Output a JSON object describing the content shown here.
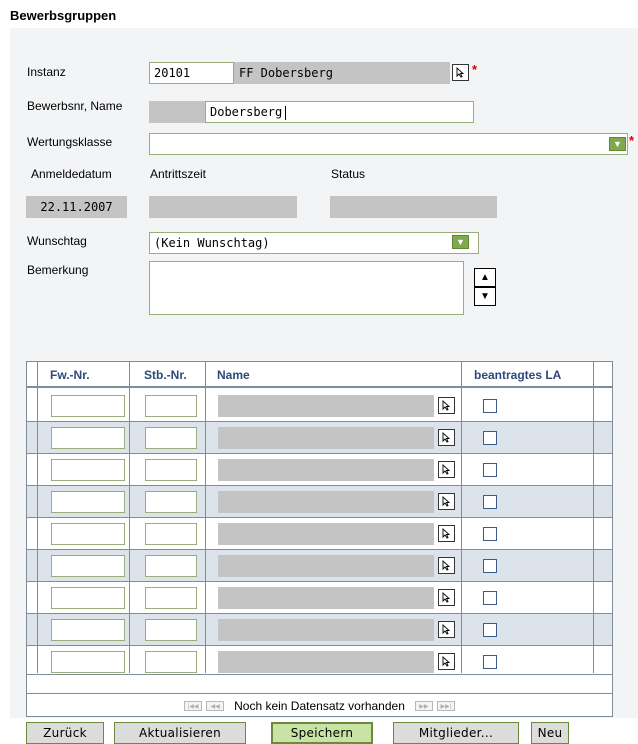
{
  "page_title": "Bewerbsgruppen",
  "form": {
    "instanz_label": "Instanz",
    "instanz_code": "20101",
    "instanz_name": "FF Dobersberg",
    "bewerbsnr_label": "Bewerbsnr, Name",
    "bewerbsnr_value": "",
    "name_value": "Dobersberg",
    "wertungsklasse_label": "Wertungsklasse",
    "wertungsklasse_value": "",
    "anmeldedatum_label": "Anmeldedatum",
    "anmeldedatum_value": "22.11.2007",
    "antrittszeit_label": "Antrittszeit",
    "antrittszeit_value": "",
    "status_label": "Status",
    "status_value": "",
    "wunschtag_label": "Wunschtag",
    "wunschtag_value": "(Kein Wunschtag)",
    "bemerkung_label": "Bemerkung",
    "bemerkung_value": "",
    "required_mark": "*"
  },
  "grid": {
    "headers": [
      "Fw.-Nr.",
      "Stb.-Nr.",
      "Name",
      "beantragtes LA"
    ],
    "rows": [
      {
        "fw": "",
        "stb": "",
        "name": "",
        "la": false
      },
      {
        "fw": "",
        "stb": "",
        "name": "",
        "la": false
      },
      {
        "fw": "",
        "stb": "",
        "name": "",
        "la": false
      },
      {
        "fw": "",
        "stb": "",
        "name": "",
        "la": false
      },
      {
        "fw": "",
        "stb": "",
        "name": "",
        "la": false
      },
      {
        "fw": "",
        "stb": "",
        "name": "",
        "la": false
      },
      {
        "fw": "",
        "stb": "",
        "name": "",
        "la": false
      },
      {
        "fw": "",
        "stb": "",
        "name": "",
        "la": false
      },
      {
        "fw": "",
        "stb": "",
        "name": "",
        "la": false
      }
    ],
    "pager_text": "Noch kein Datensatz vorhanden"
  },
  "buttons": {
    "zurueck": "Zurück",
    "aktualisieren": "Aktualisieren",
    "speichern": "Speichern",
    "mitglieder": "Mitglieder...",
    "neu": "Neu"
  },
  "colors": {
    "row_alt": "#dde3ea",
    "header_text": "#2c4a7a",
    "input_border": "#9aae7c",
    "readonly_fill": "#c4c4c4",
    "required": "#e00000"
  },
  "icons": {
    "picker": "pointer-cursor-icon",
    "dropdown": "chevron-down-icon",
    "spin_up": "arrow-up-icon",
    "spin_down": "arrow-down-icon",
    "pager_first": "first-page-icon",
    "pager_prev": "prev-page-icon",
    "pager_next": "next-page-icon",
    "pager_last": "last-page-icon"
  }
}
